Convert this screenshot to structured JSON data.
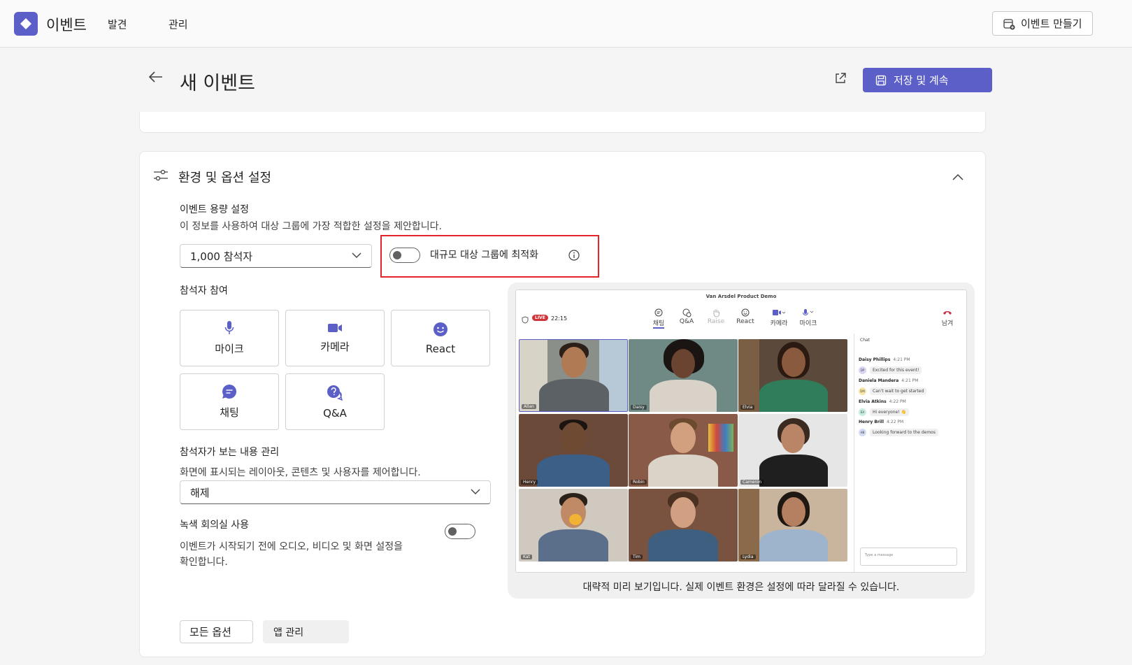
{
  "app": {
    "title": "이벤트",
    "nav": [
      "발견",
      "관리"
    ],
    "create_label": "이벤트 만들기"
  },
  "page": {
    "title": "새 이벤트",
    "save_label": "저장 및 계속"
  },
  "section": {
    "title": "환경 및 옵션 설정"
  },
  "capacity": {
    "title": "이벤트 용량 설정",
    "desc": "이 정보를 사용하여 대상 그룹에 가장 적합한 설정을 제안합니다.",
    "selected": "1,000 참석자",
    "optimize_label": "대규모 대상 그룹에 최적화",
    "optimize_on": false
  },
  "participation": {
    "title": "참석자 참여",
    "tiles": [
      {
        "label": "마이크",
        "icon": "mic-icon"
      },
      {
        "label": "카메라",
        "icon": "camera-icon"
      },
      {
        "label": "React",
        "icon": "smile-icon"
      },
      {
        "label": "채팅",
        "icon": "chat-icon"
      },
      {
        "label": "Q&A",
        "icon": "qa-icon"
      }
    ]
  },
  "view": {
    "title": "참석자가 보는 내용 관리",
    "desc": "화면에 표시되는 레이아웃, 콘텐츠 및 사용자를 제어합니다.",
    "selected": "해제"
  },
  "green_room": {
    "title": "녹색 회의실 사용",
    "desc_line1": "이벤트가 시작되기 전에 오디오, 비디오 및 화면 설정을",
    "desc_line2": "확인합니다.",
    "on": false
  },
  "preview": {
    "window_title": "Van Arsdel Product Demo",
    "live": "LIVE",
    "time": "22:15",
    "toolbar": [
      "채팅",
      "Q&A",
      "Raise",
      "React",
      "카메라",
      "마이크"
    ],
    "leave": "남겨",
    "participants": [
      "Allan",
      "Daisy",
      "Elvia",
      "Henry",
      "Robin",
      "Cameron",
      "Kat",
      "Tim",
      "Lydia"
    ],
    "chat": {
      "title": "Chat",
      "messages": [
        {
          "name": "Daisy Phillips",
          "time": "4:21 PM",
          "initials": "DP",
          "text": "Excited for this event!"
        },
        {
          "name": "Daniela Mandera",
          "time": "4:21 PM",
          "initials": "DM",
          "text": "Can't wait to get started"
        },
        {
          "name": "Elvia Atkins",
          "time": "4:22 PM",
          "initials": "EA",
          "text": "Hi everyone! 👋"
        },
        {
          "name": "Henry Brill",
          "time": "4:22 PM",
          "initials": "HB",
          "text": "Looking forward to the demos"
        }
      ],
      "placeholder": "Type a message"
    },
    "caption": "대략적 미리 보기입니다. 실제 이벤트 환경은 설정에 따라 달라질 수 있습니다."
  },
  "footer": {
    "all_options": "모든 옵션",
    "app_manage": "앱 관리"
  },
  "colors": {
    "accent": "#5b5fc7",
    "highlight": "#e3252b"
  }
}
